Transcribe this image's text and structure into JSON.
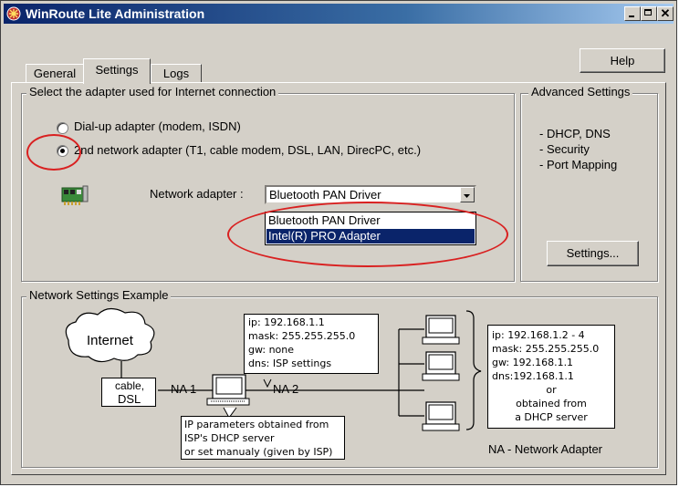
{
  "window": {
    "title": "WinRoute Lite Administration",
    "controls": [
      "_",
      "□",
      "×"
    ]
  },
  "tabs": [
    {
      "label": "General"
    },
    {
      "label": "Settings"
    },
    {
      "label": "Logs"
    }
  ],
  "help_button": "Help",
  "adapter_group": {
    "legend": "Select the adapter used for Internet connection",
    "option_dialup": "Dial-up adapter (modem, ISDN)",
    "option_network": "2nd network adapter (T1, cable modem, DSL, LAN, DirecPC, etc.)",
    "selected": "2nd network adapter",
    "network_adapter_label": "Network adapter :",
    "network_adapter_value": "Bluetooth PAN Driver",
    "dropdown_options": [
      "Bluetooth PAN Driver",
      "Intel(R) PRO Adapter"
    ],
    "highlighted_option": "Intel(R) PRO Adapter"
  },
  "advanced_group": {
    "legend": "Advanced Settings",
    "items": [
      "- DHCP, DNS",
      "- Security",
      "- Port Mapping"
    ],
    "settings_button": "Settings..."
  },
  "example_group": {
    "legend": "Network Settings Example",
    "internet_label": "Internet",
    "cable_label_1": "cable,",
    "cable_label_2": "DSL",
    "na1": "NA 1",
    "na2": "NA 2",
    "router_info": [
      "ip: 192.168.1.1",
      "mask: 255.255.255.0",
      "gw: none",
      "dns: ISP settings"
    ],
    "ip_note": [
      "IP parameters obtained from",
      "ISP's DHCP server",
      "or set manualy (given by ISP)"
    ],
    "clients_info": [
      "ip: 192.168.1.2 - 4",
      "mask: 255.255.255.0",
      "gw: 192.168.1.1",
      "dns:192.168.1.1",
      "or",
      "obtained from",
      "a DHCP server"
    ],
    "na_legend": "NA - Network Adapter"
  },
  "colors": {
    "title_start": "#0a246a",
    "title_end": "#a6caf0",
    "selection": "#0a246a",
    "annotation": "#d92020",
    "face": "#d4d0c8"
  }
}
